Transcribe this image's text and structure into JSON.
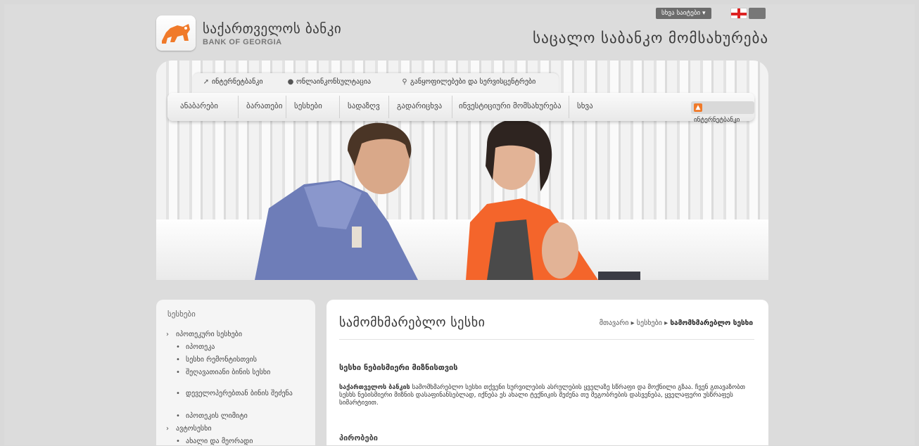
{
  "header": {
    "bank_name_ka": "საქართველოს ბანკი",
    "bank_name_en": "BANK OF GEORGIA",
    "section_title": "საცალო საბანკო მომსახურება",
    "lang_selector": "სხვა საიტები ▾",
    "lang_flag_ge": "GE",
    "lang_flag_en": "EN"
  },
  "toplinks": [
    {
      "icon": "cursor-icon",
      "label": "ინტერნეტბანკი"
    },
    {
      "icon": "chat-icon",
      "label": "ონლაინკონსულტაცია"
    },
    {
      "icon": "pin-icon",
      "label": "განყოფილებები და სერვისცენტრები"
    }
  ],
  "mainnav": {
    "items": [
      "ანაბარები",
      "ბარათები",
      "სესხები",
      "სადაზღვ",
      "გადარიცხვა",
      "ინვესტიციური მომსახურება",
      "სხვა"
    ],
    "internet_bank_button": "ინტერნეტბანკი"
  },
  "sidebar": {
    "title": "სესხები",
    "items": [
      {
        "level": 1,
        "label": "იპოთეკური სესხები"
      },
      {
        "level": 2,
        "label": "იპოთეკა"
      },
      {
        "level": 2,
        "label": "სესხი რემონტისთვის"
      },
      {
        "level": 2,
        "label": "შეღავათიანი ბინის სესხი"
      },
      {
        "level": 2,
        "label": "დეველოპერებთან ბინის შეძენა"
      },
      {
        "level": 2,
        "label": "იპოთეკის ლიმიტი"
      },
      {
        "level": 1,
        "label": "ავტოსესხი"
      },
      {
        "level": 2,
        "label": "ახალი და მეორადი"
      }
    ]
  },
  "content": {
    "title": "სამომხმარებლო სესხი",
    "breadcrumbs": [
      "მთავარი",
      "სესხები",
      "სამომხმარებლო სესხი"
    ],
    "heading": "სესხი ნებისმიერი მიზნისთვის",
    "paragraph_bold": "საქართველოს ბანკის",
    "paragraph": " სამომხმარებლო სესხი თქვენი სურვილების ასრულების ყველაზე სწრაფი და მოქნილი გზაა. ჩვენ გთავაზობთ სესხს ნებისმიერი მიზნის დასაფინანსებლად, იქნება ეს ახალი ტექნიკის შეძენა თუ მეგობრების დასვენება, ყველაფერი უსწრაფეს სიმარტივით.",
    "subheading": "პირობები"
  },
  "colors": {
    "accent": "#f07a2a",
    "background": "#d9d9d9"
  }
}
